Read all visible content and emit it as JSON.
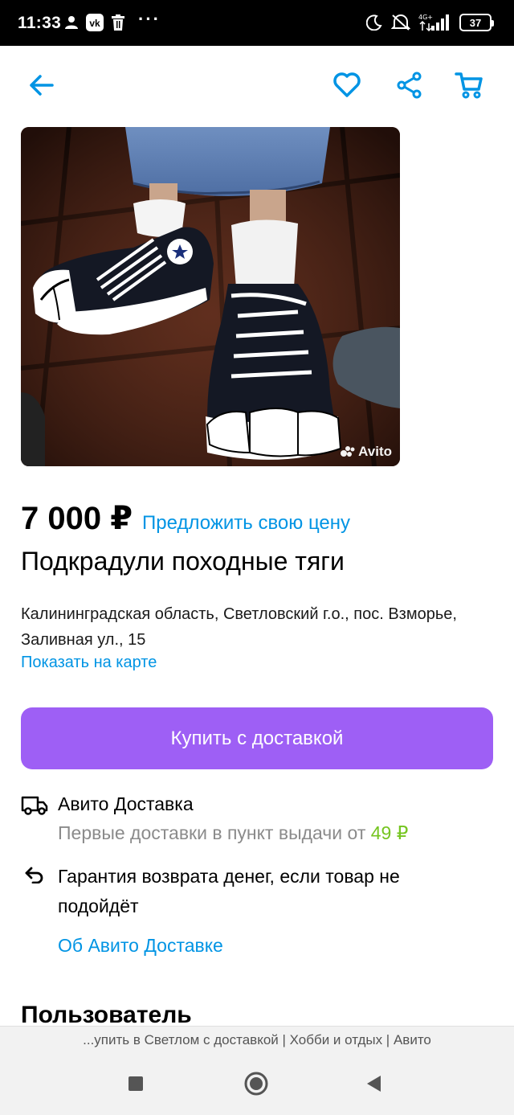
{
  "status_bar": {
    "time": "11:33",
    "network_label": "4G+",
    "battery": "37",
    "icons": [
      "person-icon",
      "vk-icon",
      "trash-icon",
      "more-dots-icon",
      "moon-icon",
      "mute-icon",
      "signal-icon",
      "battery-icon"
    ]
  },
  "app_bar": {
    "icons": [
      "back-arrow-icon",
      "heart-icon",
      "share-icon",
      "cart-icon"
    ],
    "accent_color": "#0094e4"
  },
  "listing": {
    "photo_watermark": "Avito",
    "price": "7 000 ₽",
    "offer_link": "Предложить свою цену",
    "title": "Подкрадули походные тяги",
    "address": "Калининградская область, Светловский г.о., пос. Взморье, Заливная ул., 15",
    "map_link": "Показать на карте",
    "buy_button": "Купить с доставкой",
    "buy_button_color": "#9e5ff5"
  },
  "delivery": {
    "title": "Авито Доставка",
    "subtitle_prefix": "Первые доставки в пункт выдачи от",
    "price": "49 ₽",
    "price_color": "#75c520",
    "guarantee": "Гарантия возврата денег, если товар не подойдёт",
    "about_link": "Об Авито Доставке"
  },
  "user_section": {
    "title": "Пользователь"
  },
  "browser": {
    "url_title": "...упить в Светлом с доставкой | Хобби и отдых | Авито"
  },
  "nav_bar": {
    "icons": [
      "recent-apps-icon",
      "home-icon",
      "back-triangle-icon"
    ]
  }
}
